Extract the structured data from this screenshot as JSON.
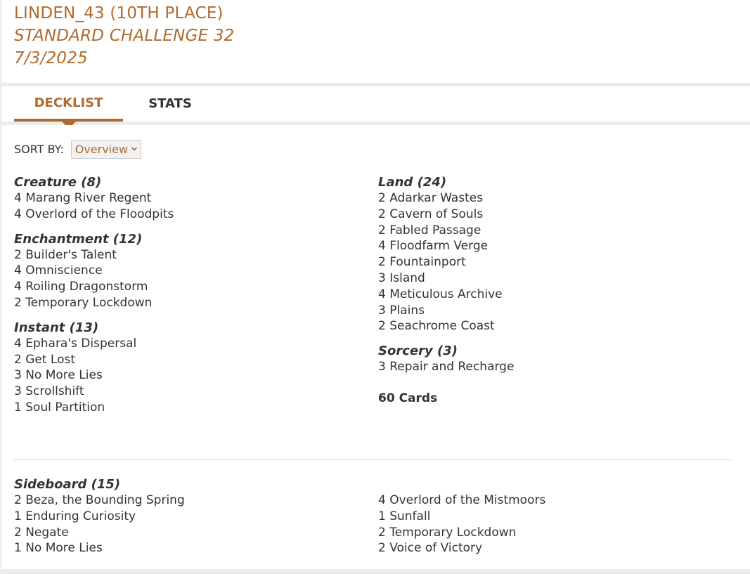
{
  "header": {
    "player": "LINDEN_43 (10TH PLACE)",
    "event": "STANDARD CHALLENGE 32",
    "date": "7/3/2025"
  },
  "tabs": [
    {
      "label": "DECKLIST",
      "active": true
    },
    {
      "label": "STATS",
      "active": false
    }
  ],
  "sort": {
    "label": "SORT BY:",
    "selected": "Overview",
    "icon": "chevron-down-icon"
  },
  "colors": {
    "accent": "#b06a2e",
    "text": "#333333",
    "background": "#ececec"
  },
  "main_left": [
    {
      "title": "Creature (8)",
      "cards": [
        "4 Marang River Regent",
        "4 Overlord of the Floodpits"
      ]
    },
    {
      "title": "Enchantment (12)",
      "cards": [
        "2 Builder's Talent",
        "4 Omniscience",
        "4 Roiling Dragonstorm",
        "2 Temporary Lockdown"
      ]
    },
    {
      "title": "Instant (13)",
      "cards": [
        "4 Ephara's Dispersal",
        "2 Get Lost",
        "3 No More Lies",
        "3 Scrollshift",
        "1 Soul Partition"
      ]
    }
  ],
  "main_right": [
    {
      "title": "Land (24)",
      "cards": [
        "2 Adarkar Wastes",
        "2 Cavern of Souls",
        "2 Fabled Passage",
        "4 Floodfarm Verge",
        "2 Fountainport",
        "3 Island",
        "4 Meticulous Archive",
        "3 Plains",
        "2 Seachrome Coast"
      ]
    },
    {
      "title": "Sorcery (3)",
      "cards": [
        "3 Repair and Recharge"
      ]
    }
  ],
  "total": "60 Cards",
  "sideboard": {
    "title": "Sideboard (15)",
    "left": [
      "2 Beza, the Bounding Spring",
      "1 Enduring Curiosity",
      "2 Negate",
      "1 No More Lies"
    ],
    "right": [
      "4 Overlord of the Mistmoors",
      "1 Sunfall",
      "2 Temporary Lockdown",
      "2 Voice of Victory"
    ]
  }
}
